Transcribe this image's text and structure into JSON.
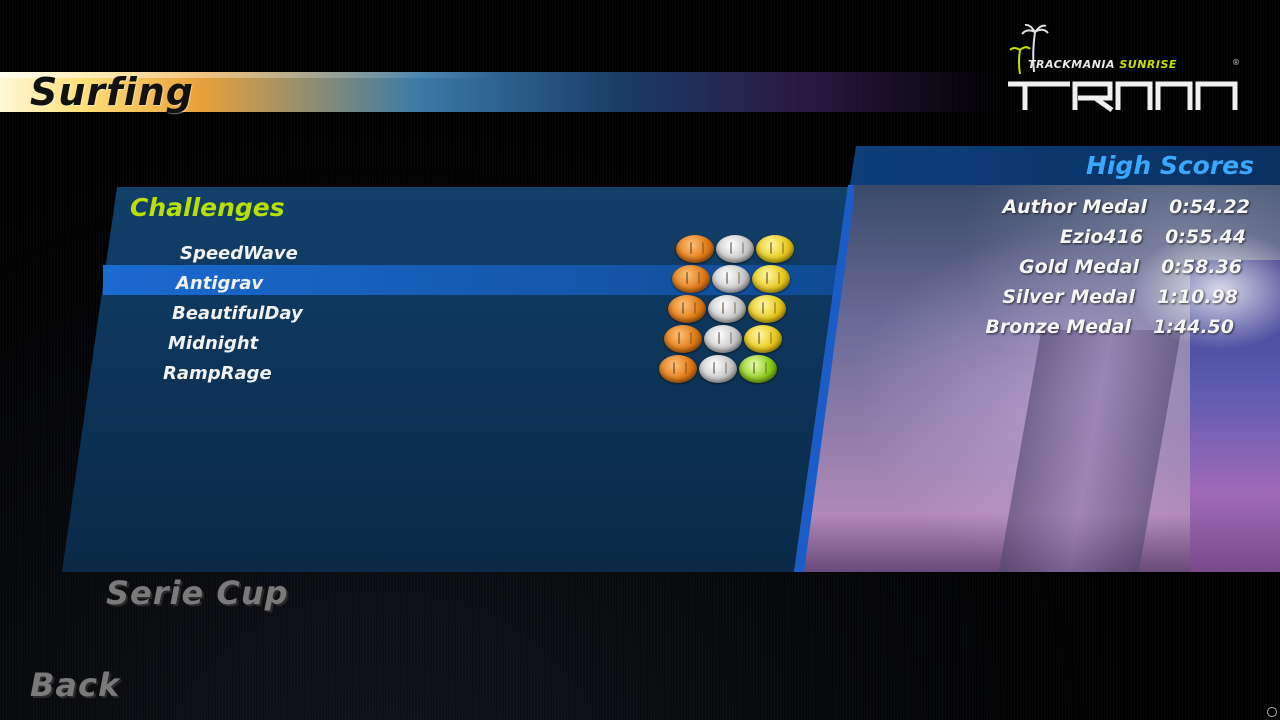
{
  "page": {
    "title": "Surfing"
  },
  "logo": {
    "brand": "TRACKMANIA",
    "edition": "SUNRISE",
    "registered": "®",
    "icon": "palm-trees-logo"
  },
  "challenges": {
    "heading": "Challenges",
    "items": [
      {
        "name": "SpeedWave",
        "medals": [
          "bronze",
          "silver",
          "gold"
        ],
        "selected": false
      },
      {
        "name": "Antigrav",
        "medals": [
          "bronze",
          "silver",
          "gold"
        ],
        "selected": true
      },
      {
        "name": "BeautifulDay",
        "medals": [
          "bronze",
          "silver",
          "gold"
        ],
        "selected": false
      },
      {
        "name": "Midnight",
        "medals": [
          "bronze",
          "silver",
          "gold"
        ],
        "selected": false
      },
      {
        "name": "RampRage",
        "medals": [
          "bronze",
          "silver",
          "nadeo"
        ],
        "selected": false
      }
    ]
  },
  "high_scores": {
    "heading": "High Scores",
    "rows": [
      {
        "label": "Author Medal",
        "time": "0:54.22"
      },
      {
        "label": "Ezio416",
        "time": "0:55.44"
      },
      {
        "label": "Gold Medal",
        "time": "0:58.36"
      },
      {
        "label": "Silver Medal",
        "time": "1:10.98"
      },
      {
        "label": "Bronze Medal",
        "time": "1:44.50"
      }
    ]
  },
  "footer": {
    "serie_cup": "Serie Cup",
    "back": "Back"
  },
  "colors": {
    "challenges_heading": "#b8e000",
    "scores_heading": "#3aa8ff",
    "selected_row": "#1a6ad0"
  }
}
